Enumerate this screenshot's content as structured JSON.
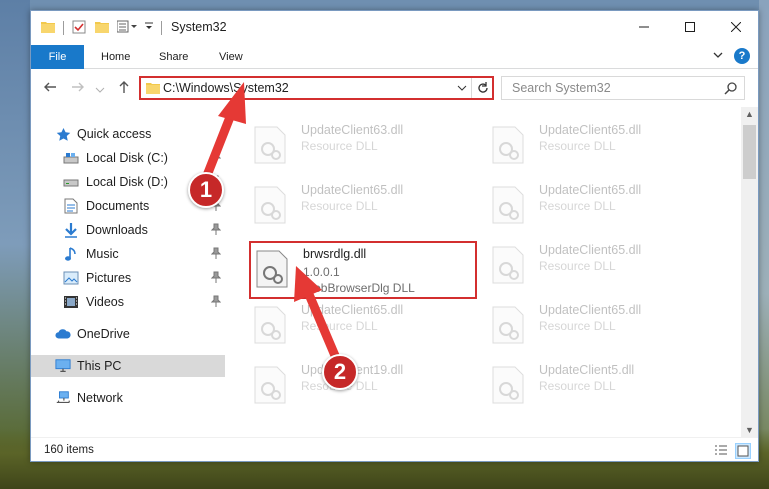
{
  "window": {
    "title": "System32"
  },
  "ribbon": {
    "file": "File",
    "home": "Home",
    "share": "Share",
    "view": "View"
  },
  "address": {
    "path": "C:\\Windows\\System32"
  },
  "search": {
    "placeholder": "Search System32"
  },
  "nav": {
    "quick_access": "Quick access",
    "local_c": "Local Disk (C:)",
    "local_d": "Local Disk (D:)",
    "documents": "Documents",
    "downloads": "Downloads",
    "music": "Music",
    "pictures": "Pictures",
    "videos": "Videos",
    "onedrive": "OneDrive",
    "this_pc": "This PC",
    "network": "Network"
  },
  "files": {
    "f1": {
      "name": "UpdateClient63.dll",
      "desc": "Resource DLL"
    },
    "f2": {
      "name": "UpdateClient65.dll",
      "desc": "Resource DLL"
    },
    "f3": {
      "name": "UpdateClient65.dll",
      "desc": "Resource DLL"
    },
    "f4": {
      "name": "UpdateClient65.dll",
      "desc": "Resource DLL"
    },
    "selected": {
      "name": "brwsrdlg.dll",
      "version": "1.0.0.1",
      "desc": "WebBrowserDlg DLL"
    },
    "f6": {
      "name": "UpdateClient65.dll",
      "desc": "Resource DLL"
    },
    "f7": {
      "name": "UpdateClient65.dll",
      "desc": "Resource DLL"
    },
    "f8": {
      "name": "UpdateClient65.dll",
      "desc": "Resource DLL"
    },
    "f9": {
      "name": "UpdateClient19.dll",
      "desc": "Resource DLL"
    },
    "f10": {
      "name": "UpdateClient5.dll",
      "desc": "Resource DLL"
    }
  },
  "status": {
    "count": "160 items"
  },
  "annotations": {
    "step1": "1",
    "step2": "2"
  },
  "colors": {
    "accent": "#1979ca",
    "highlight": "#d32f2f",
    "badge": "#c62828"
  }
}
